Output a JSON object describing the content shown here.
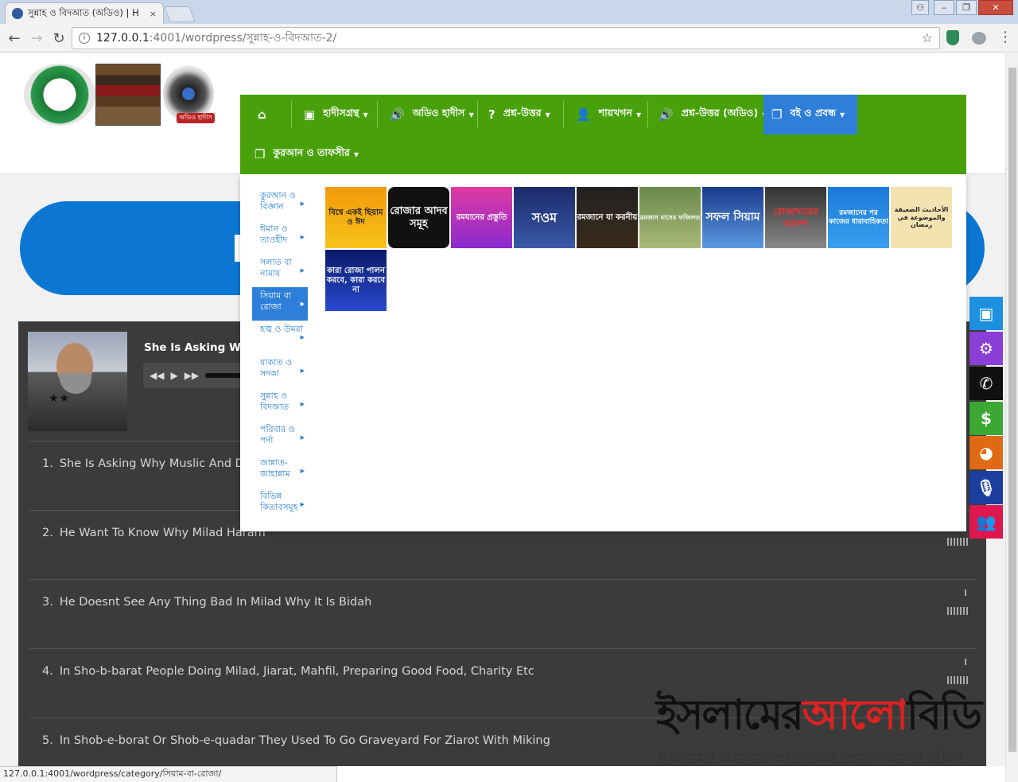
{
  "browser": {
    "tab_title": "সুন্নাহ ও বিদআত (অডিও) | H",
    "tab_close": "×",
    "url_host": "127.0.0.1",
    "url_path": ":4001/wordpress/সুন্নাহ-ও-বিদআত-2/",
    "status_url": "127.0.0.1:4001/wordpress/category/সিয়াম-বা-রোজা/"
  },
  "nav": {
    "items": [
      {
        "label": "",
        "icon": "home-icon"
      },
      {
        "label": "হাদীসগ্রন্থ",
        "icon": "archive-icon"
      },
      {
        "label": "অডিও হাদীস",
        "icon": "volume-icon"
      },
      {
        "label": "প্রশ্ন-উত্তর",
        "icon": "question-icon"
      },
      {
        "label": "শায়খগন",
        "icon": "user-icon"
      },
      {
        "label": "প্রশ্ন-উত্তর (অডিও)",
        "icon": "volume-icon"
      },
      {
        "label": "বই ও প্রবন্ধ",
        "icon": "copy-icon"
      },
      {
        "label": "কুরআন ও তাফসীর",
        "icon": "copy-icon"
      }
    ]
  },
  "dropdown": {
    "categories": [
      "কুরআন ও বিজ্ঞান",
      "ঈমান ও তাওহীদ",
      "সলাত বা নামায",
      "সিয়াম বা রোজা",
      "হজ্ব ও উমরা",
      "যাকাত ও সদকা",
      "সুন্নাহ ও বিদআত",
      "পরিবার ও পর্দা",
      "জান্নাত-জাহান্নাম",
      "বিভিন্ন কিতাবসমূহ"
    ],
    "thumbs": [
      "বিশ্বে একই ছিয়াম ও ঈদ",
      "রোজার আদব সমূহ",
      "রমযানের প্রস্তুতি",
      "সওম",
      "রমজানে যা করনীয়",
      "রমজান মাসের ফজিলত",
      "সফল সিয়াম",
      "রোজাদারের আনন্দ",
      "রমজানের পর কাজের ধারাবাহিকতা",
      "الأحاديث الضعيفة والموضوعة في رمضان",
      "কারা রোজা পালন করবে, কারা করবে না"
    ]
  },
  "player": {
    "now_playing": "She Is Asking Why",
    "rating": "★★",
    "tracks": [
      {
        "num": "1.",
        "title": "She Is Asking Why Muslic And Danc"
      },
      {
        "num": "2.",
        "title": "He Want To Know Why Milad Haram"
      },
      {
        "num": "3.",
        "title": "He Doesnt See Any Thing Bad In Milad Why It Is Bidah"
      },
      {
        "num": "4.",
        "title": "In Sho-b-barat People Doing Milad, Jiarat, Mahfil, Preparing Good Food, Charity Etc"
      },
      {
        "num": "5.",
        "title": "In Shob-e-borat Or Shob-e-quadar They Used To Go Graveyard For Ziarot With Miking"
      }
    ]
  },
  "watermark": {
    "line1_a": "ইসলামের",
    "line1_b": "আলো",
    "line1_c": "বিডি",
    "line2": "ইসলামের আলোয় আলোকিত হোক সকলের জীবন"
  },
  "logo": {
    "caption": "অডিও হাদীস"
  },
  "side_icons": [
    {
      "name": "contact-card-icon",
      "color": "#1e90e0"
    },
    {
      "name": "gears-icon",
      "color": "#8a3fd6"
    },
    {
      "name": "phone-icon",
      "color": "#111111"
    },
    {
      "name": "dollar-icon",
      "color": "#3aa832"
    },
    {
      "name": "globe-icon",
      "color": "#e06a14"
    },
    {
      "name": "microphone-icon",
      "color": "#1c3f9e"
    },
    {
      "name": "users-icon",
      "color": "#e0174f"
    }
  ],
  "colors": {
    "nav_green": "#48a10a",
    "nav_active": "#2e7fd9",
    "banner_blue": "#0b77d3",
    "player_bg": "#3b3b3b"
  }
}
